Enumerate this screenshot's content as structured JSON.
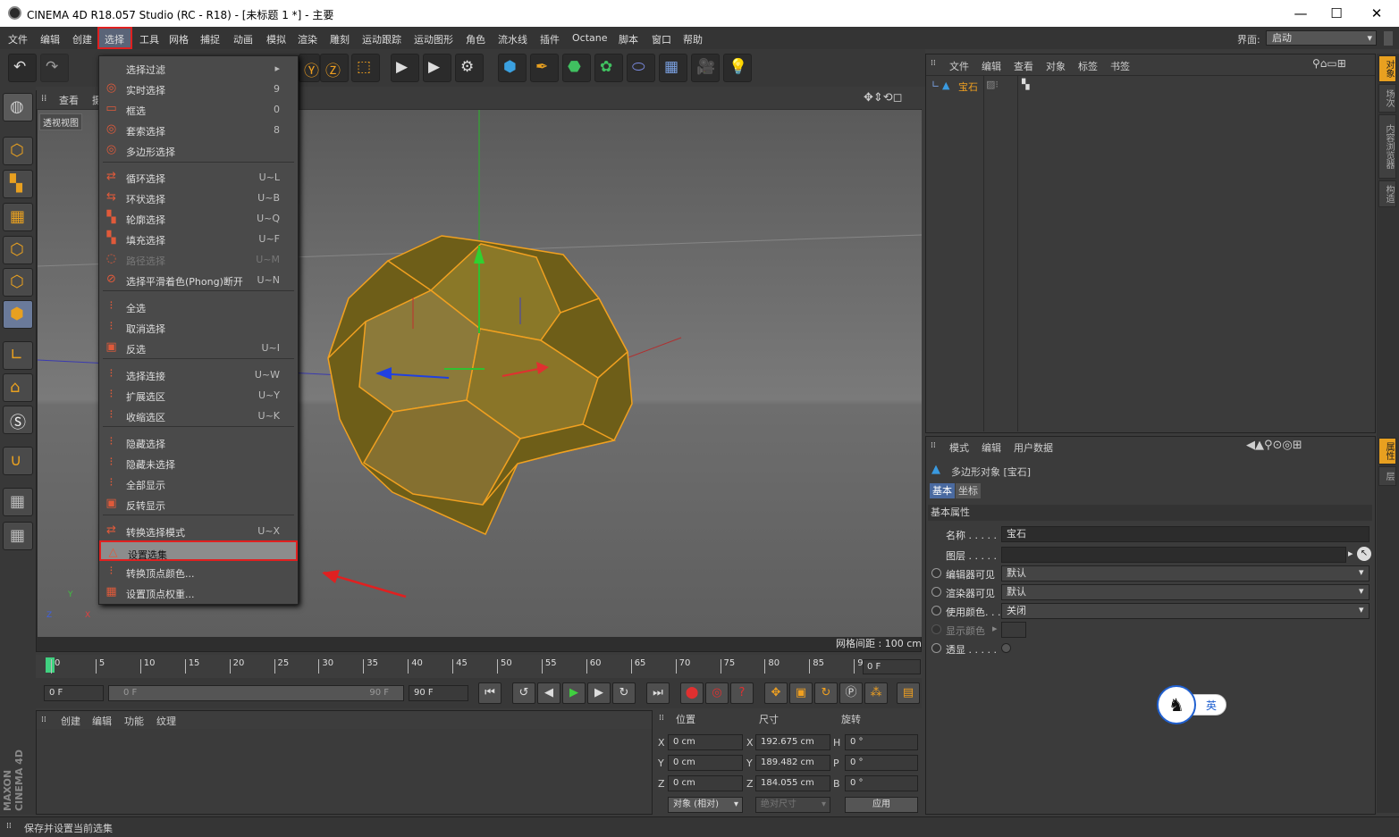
{
  "window": {
    "title": "CINEMA 4D R18.057 Studio (RC - R18) - [未标题 1 *] - 主要",
    "minimize": "—",
    "maximize": "☐",
    "close": "✕"
  },
  "menubar": {
    "items": [
      "文件",
      "编辑",
      "创建",
      "选择",
      "工具",
      "网格",
      "捕捉",
      "动画",
      "模拟",
      "渲染",
      "雕刻",
      "运动跟踪",
      "运动图形",
      "角色",
      "流水线",
      "插件",
      "Octane",
      "脚本",
      "窗口",
      "帮助"
    ],
    "layout_label": "界面:",
    "layout_value": "启动"
  },
  "select_menu": {
    "items": [
      {
        "label": "选择过滤",
        "shortcut": "▸",
        "icon": ""
      },
      {
        "label": "实时选择",
        "shortcut": "9",
        "icon": "◎"
      },
      {
        "label": "框选",
        "shortcut": "0",
        "icon": "▭"
      },
      {
        "label": "套索选择",
        "shortcut": "8",
        "icon": "◎"
      },
      {
        "label": "多边形选择",
        "shortcut": "",
        "icon": "◎"
      },
      {
        "label": "循环选择",
        "shortcut": "U~L",
        "icon": "⇄"
      },
      {
        "label": "环状选择",
        "shortcut": "U~B",
        "icon": "⇆"
      },
      {
        "label": "轮廓选择",
        "shortcut": "U~Q",
        "icon": "▚"
      },
      {
        "label": "填充选择",
        "shortcut": "U~F",
        "icon": "▚"
      },
      {
        "label": "路径选择",
        "shortcut": "U~M",
        "icon": "◌"
      },
      {
        "label": "选择平滑着色(Phong)断开",
        "shortcut": "U~N",
        "icon": "⊘"
      },
      {
        "label": "全选",
        "shortcut": "",
        "icon": "⁝"
      },
      {
        "label": "取消选择",
        "shortcut": "",
        "icon": "⁝"
      },
      {
        "label": "反选",
        "shortcut": "U~I",
        "icon": "▣"
      },
      {
        "label": "选择连接",
        "shortcut": "U~W",
        "icon": "⁝"
      },
      {
        "label": "扩展选区",
        "shortcut": "U~Y",
        "icon": "⁝"
      },
      {
        "label": "收缩选区",
        "shortcut": "U~K",
        "icon": "⁝"
      },
      {
        "label": "隐藏选择",
        "shortcut": "",
        "icon": "⁝"
      },
      {
        "label": "隐藏未选择",
        "shortcut": "",
        "icon": "⁝"
      },
      {
        "label": "全部显示",
        "shortcut": "",
        "icon": "⁝"
      },
      {
        "label": "反转显示",
        "shortcut": "",
        "icon": "▣"
      },
      {
        "label": "转换选择模式",
        "shortcut": "U~X",
        "icon": "⇄"
      },
      {
        "label": "设置选集",
        "shortcut": "",
        "icon": "△"
      },
      {
        "label": "转换顶点颜色...",
        "shortcut": "",
        "icon": "⁝"
      },
      {
        "label": "设置顶点权重...",
        "shortcut": "",
        "icon": "▦"
      }
    ]
  },
  "viewport": {
    "menu": [
      "查看",
      "摄"
    ],
    "mode_label": "透视视图",
    "grid_info": "网格间距 : 100 cm",
    "axis_y": "Y",
    "axis_z": "Z",
    "axis_x": "X"
  },
  "timeline": {
    "ticks": [
      "0",
      "5",
      "10",
      "15",
      "20",
      "25",
      "30",
      "35",
      "40",
      "45",
      "50",
      "55",
      "60",
      "65",
      "70",
      "75",
      "80",
      "85",
      "90"
    ],
    "current_frame": "0 F",
    "start_field": "0 F",
    "range_start": "0 F",
    "range_end": "90 F",
    "end_field": "90 F"
  },
  "material_panel": {
    "menu": [
      "创建",
      "编辑",
      "功能",
      "纹理"
    ]
  },
  "coord_panel": {
    "headers": [
      "位置",
      "尺寸",
      "旋转"
    ],
    "rows": [
      {
        "axis": "X",
        "pos": "0 cm",
        "size_axis": "X",
        "size": "192.675 cm",
        "rot_axis": "H",
        "rot": "0 °"
      },
      {
        "axis": "Y",
        "pos": "0 cm",
        "size_axis": "Y",
        "size": "189.482 cm",
        "rot_axis": "P",
        "rot": "0 °"
      },
      {
        "axis": "Z",
        "pos": "0 cm",
        "size_axis": "Z",
        "size": "184.055 cm",
        "rot_axis": "B",
        "rot": "0 °"
      }
    ],
    "mode": "对象 (相对)",
    "size_mode": "绝对尺寸",
    "apply": "应用"
  },
  "object_panel": {
    "menu": [
      "文件",
      "编辑",
      "查看",
      "对象",
      "标签",
      "书签"
    ],
    "object_name": "宝石"
  },
  "attr_panel": {
    "menu": [
      "模式",
      "编辑",
      "用户数据"
    ],
    "object_title": "多边形对象 [宝石]",
    "tabs": [
      "基本",
      "坐标"
    ],
    "section": "基本属性",
    "props": [
      {
        "label": "名称 . . . . .",
        "value": "宝石"
      },
      {
        "label": "图层 . . . . .",
        "value": ""
      },
      {
        "label": "编辑器可见",
        "value": "默认"
      },
      {
        "label": "渲染器可见",
        "value": "默认"
      },
      {
        "label": "使用颜色. . .",
        "value": "关闭"
      },
      {
        "label": "显示颜色",
        "value": ""
      },
      {
        "label": "透显 . . . . .",
        "value": ""
      }
    ]
  },
  "right_tabs": [
    "对象",
    "场次",
    "内容浏览器",
    "构造",
    "属性",
    "层"
  ],
  "ime": {
    "label": "英"
  },
  "status": {
    "text": "保存并设置当前选集"
  },
  "maxon": {
    "text": "MAXON CINEMA 4D"
  },
  "colors": {
    "accent": "#e8a020",
    "highlight_border": "#e02020",
    "gem": "#8a7520"
  }
}
